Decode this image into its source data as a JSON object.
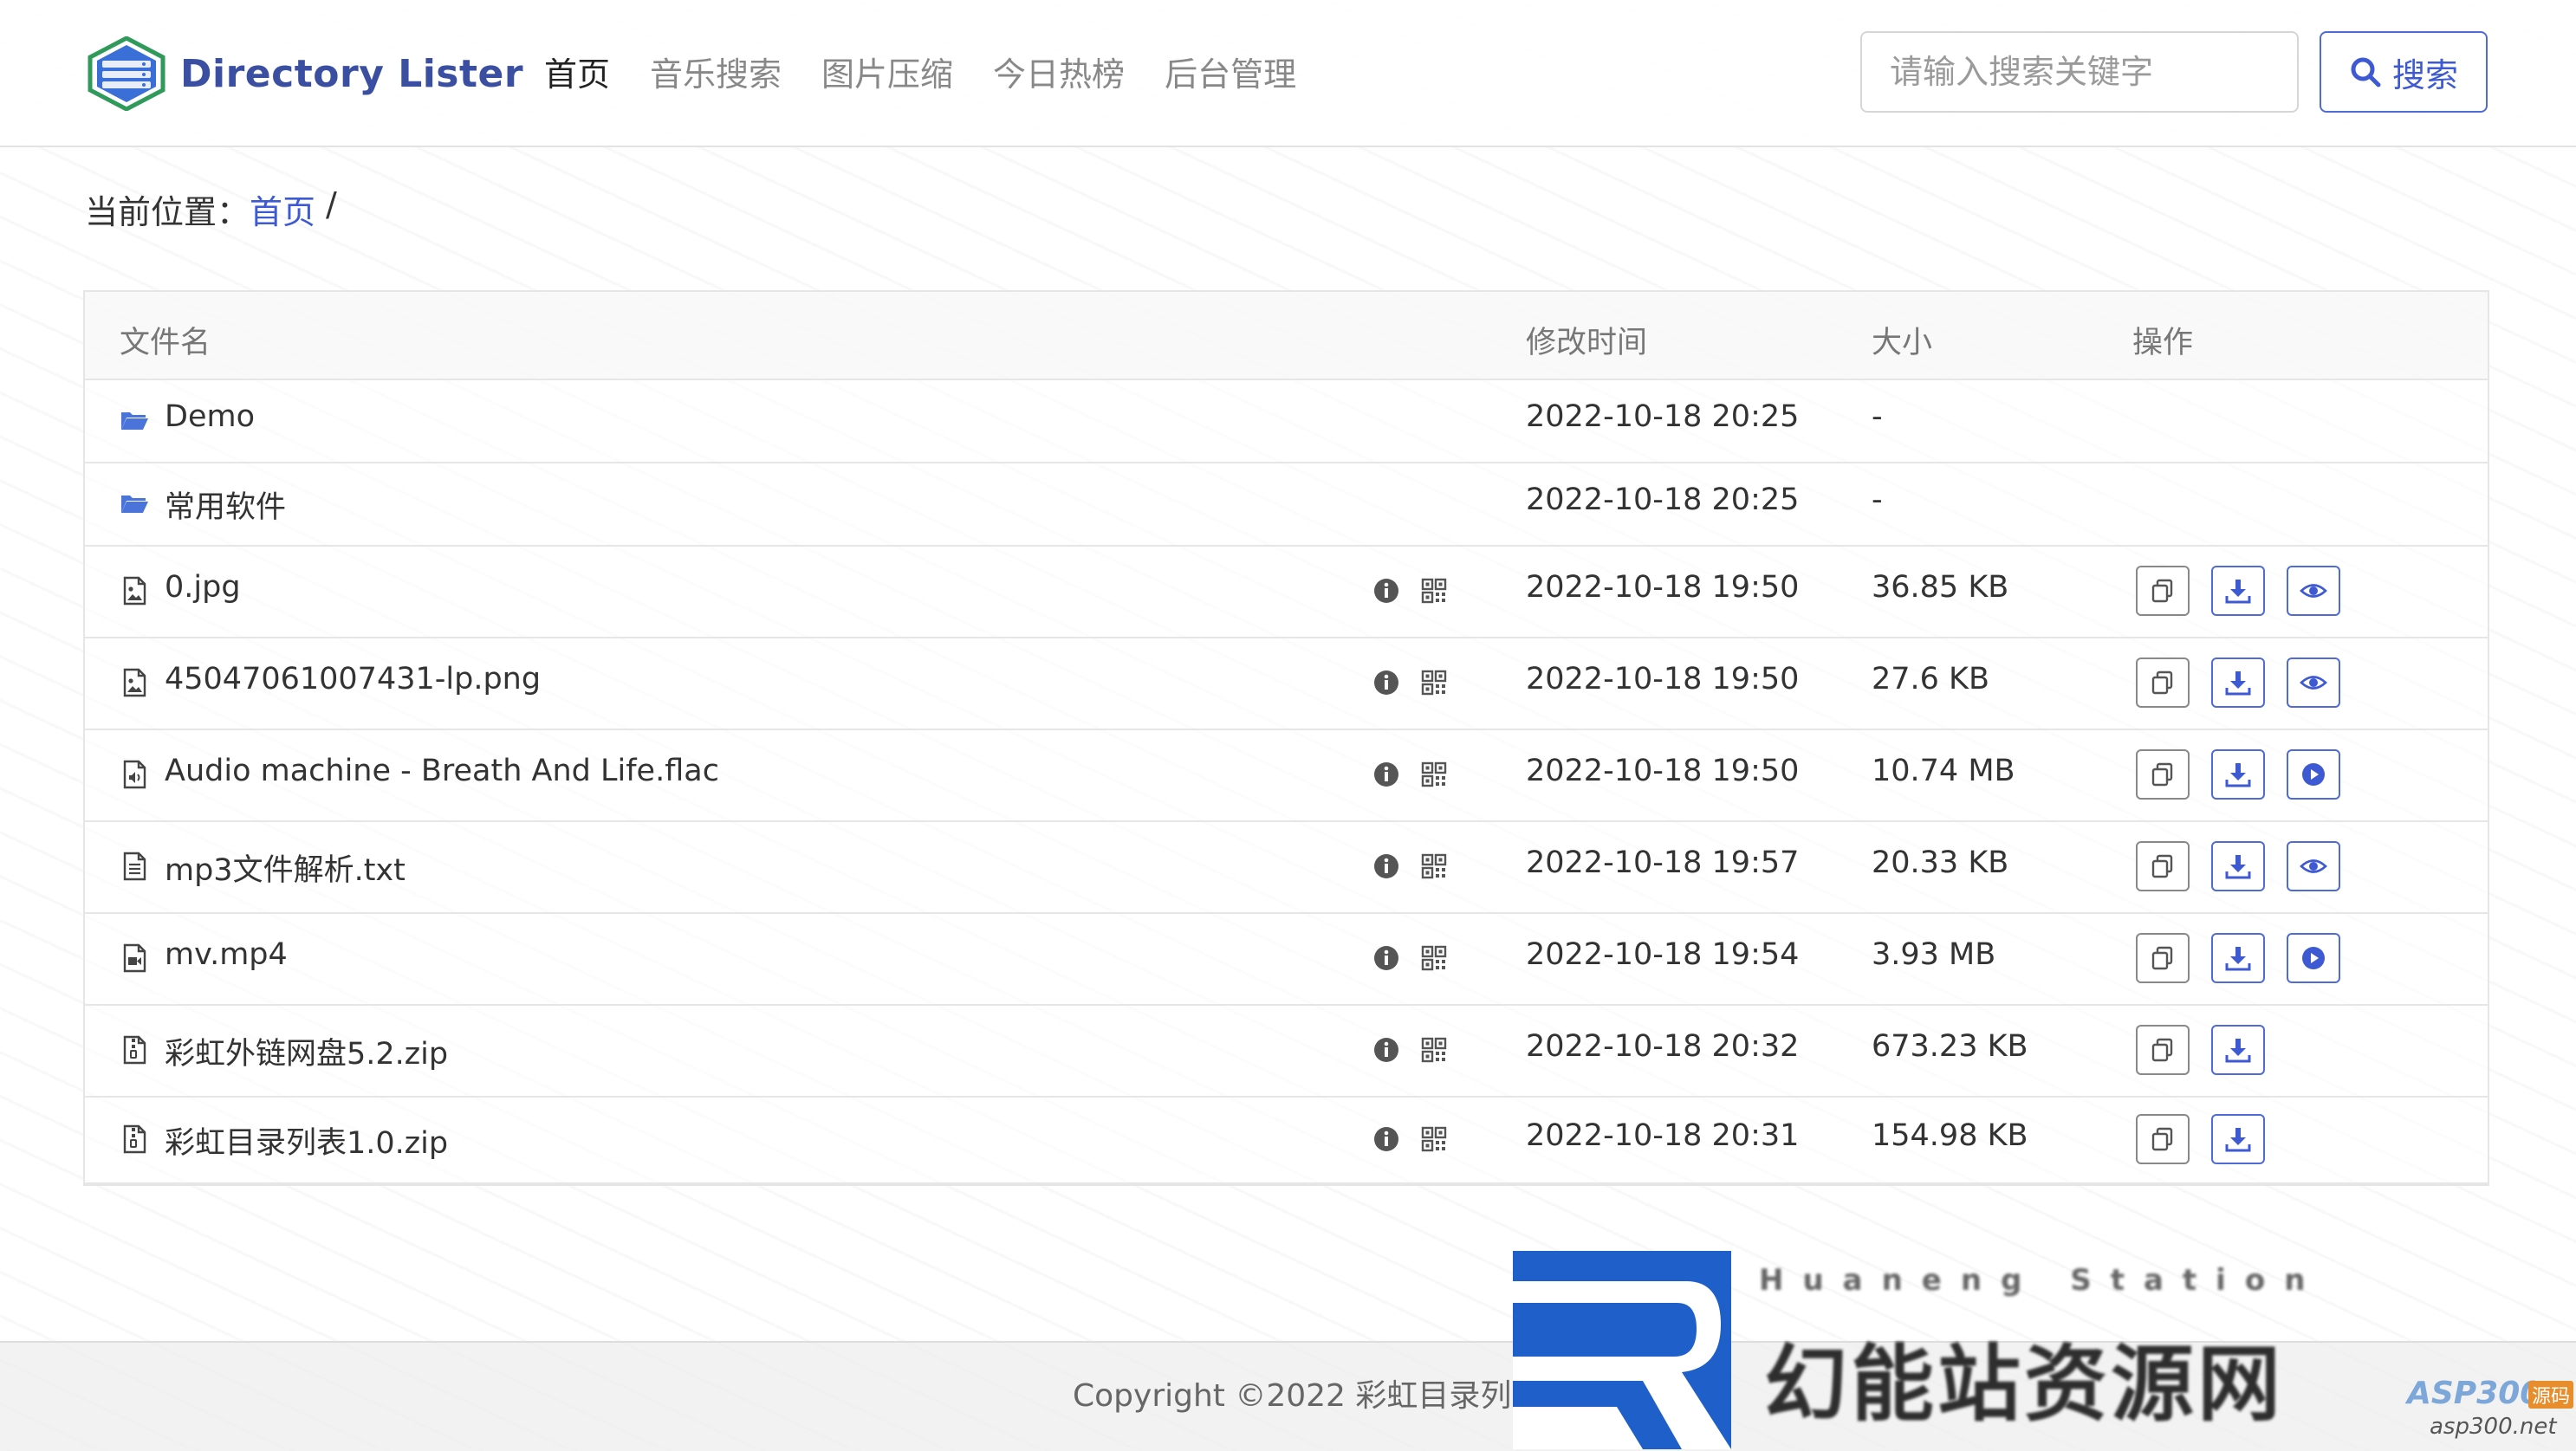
{
  "brand": {
    "name": "Directory Lister"
  },
  "nav": {
    "items": [
      {
        "label": "首页",
        "active": true
      },
      {
        "label": "音乐搜索",
        "active": false
      },
      {
        "label": "图片压缩",
        "active": false
      },
      {
        "label": "今日热榜",
        "active": false
      },
      {
        "label": "后台管理",
        "active": false
      }
    ]
  },
  "search": {
    "placeholder": "请输入搜索关键字",
    "value": "",
    "button_label": "搜索",
    "icon": "search-icon"
  },
  "breadcrumb": {
    "prefix": "当前位置：",
    "home": "首页",
    "separator": "/"
  },
  "table": {
    "columns": {
      "name": "文件名",
      "modified": "修改时间",
      "size": "大小",
      "actions": "操作"
    },
    "rows": [
      {
        "name": "Demo",
        "type": "folder",
        "modified": "2022-10-18 20:25",
        "size": "-",
        "actions": []
      },
      {
        "name": "常用软件",
        "type": "folder",
        "modified": "2022-10-18 20:25",
        "size": "-",
        "actions": []
      },
      {
        "name": "0.jpg",
        "type": "image",
        "modified": "2022-10-18 19:50",
        "size": "36.85 KB",
        "actions": [
          "copy",
          "download",
          "preview"
        ]
      },
      {
        "name": "45047061007431-lp.png",
        "type": "image",
        "modified": "2022-10-18 19:50",
        "size": "27.6 KB",
        "actions": [
          "copy",
          "download",
          "preview"
        ]
      },
      {
        "name": "Audio machine - Breath And Life.flac",
        "type": "audio",
        "modified": "2022-10-18 19:50",
        "size": "10.74 MB",
        "actions": [
          "copy",
          "download",
          "play"
        ]
      },
      {
        "name": "mp3文件解析.txt",
        "type": "text",
        "modified": "2022-10-18 19:57",
        "size": "20.33 KB",
        "actions": [
          "copy",
          "download",
          "preview"
        ]
      },
      {
        "name": "mv.mp4",
        "type": "video",
        "modified": "2022-10-18 19:54",
        "size": "3.93 MB",
        "actions": [
          "copy",
          "download",
          "play"
        ]
      },
      {
        "name": "彩虹外链网盘5.2.zip",
        "type": "archive",
        "modified": "2022-10-18 20:32",
        "size": "673.23 KB",
        "actions": [
          "copy",
          "download"
        ]
      },
      {
        "name": "彩虹目录列表1.0.zip",
        "type": "archive",
        "modified": "2022-10-18 20:31",
        "size": "154.98 KB",
        "actions": [
          "copy",
          "download"
        ]
      }
    ]
  },
  "footer": {
    "copyright": "Copyright ©2022 彩虹目录列表"
  },
  "watermark": {
    "subtitle": "Huaneng Station",
    "title": "幻能站资源网",
    "asp_label": "ASP300",
    "asp_badge": "源码",
    "url": "asp300.net"
  },
  "colors": {
    "accent": "#3d5ad3",
    "brand_text": "#3a4ea2",
    "folder": "#4a74d9",
    "border": "#e6e6e6"
  }
}
